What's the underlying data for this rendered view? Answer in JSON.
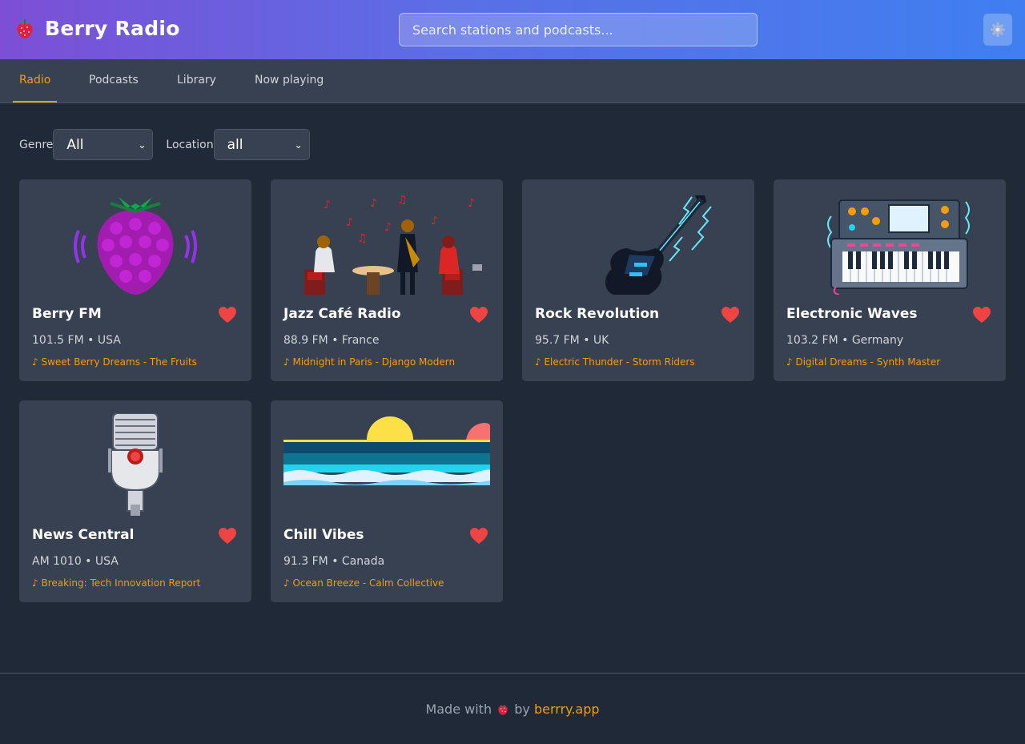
{
  "app": {
    "title": "Berry Radio",
    "logo_icon": "strawberry-icon"
  },
  "search": {
    "placeholder": "Search stations and podcasts..."
  },
  "settings": {
    "icon": "gear-icon"
  },
  "tabs": [
    {
      "label": "Radio",
      "active": true
    },
    {
      "label": "Podcasts",
      "active": false
    },
    {
      "label": "Library",
      "active": false
    },
    {
      "label": "Now playing",
      "active": false
    }
  ],
  "filters": {
    "genre": {
      "label": "Genre",
      "value": "All"
    },
    "location": {
      "label": "Location",
      "value": "all"
    }
  },
  "stations": [
    {
      "name": "Berry FM",
      "meta": "101.5 FM • USA",
      "track": "♪ Sweet Berry Dreams - The Fruits",
      "image": "raspberry-broadcast-icon",
      "favorite": true
    },
    {
      "name": "Jazz Café Radio",
      "meta": "88.9 FM • France",
      "track": "♪ Midnight in Paris - Django Modern",
      "image": "jazz-cafe-illustration",
      "favorite": true
    },
    {
      "name": "Rock Revolution",
      "meta": "95.7 FM • UK",
      "track": "♪ Electric Thunder - Storm Riders",
      "image": "electric-guitar-illustration",
      "favorite": true
    },
    {
      "name": "Electronic Waves",
      "meta": "103.2 FM • Germany",
      "track": "♪ Digital Dreams - Synth Master",
      "image": "synthesizer-illustration",
      "favorite": true
    },
    {
      "name": "News Central",
      "meta": "AM 1010 • USA",
      "track": "♪ Breaking: Tech Innovation Report",
      "image": "microphone-illustration",
      "favorite": true
    },
    {
      "name": "Chill Vibes",
      "meta": "91.3 FM • Canada",
      "track": "♪ Ocean Breeze - Calm Collective",
      "image": "ocean-sunset-illustration",
      "favorite": true
    }
  ],
  "footer": {
    "prefix": "Made with",
    "by": "by",
    "link": "berrry.app"
  },
  "colors": {
    "accent": "#f59e0b",
    "background": "#1f2937",
    "card": "#374151",
    "heart": "#ef4444"
  }
}
